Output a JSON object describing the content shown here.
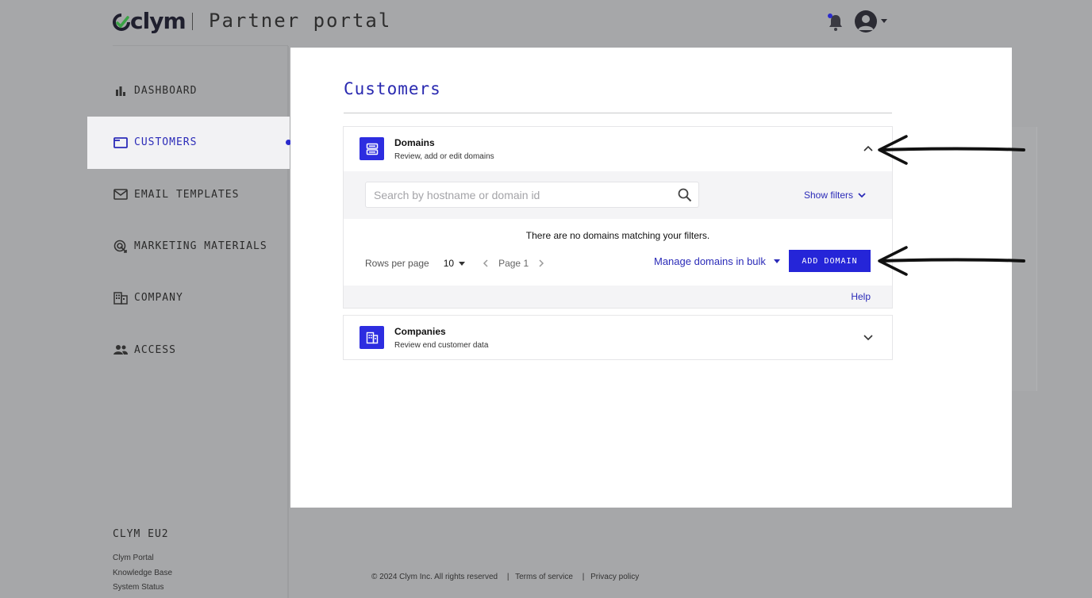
{
  "header": {
    "brand": "clym",
    "portal_title": "Partner portal"
  },
  "sidebar": {
    "items": [
      {
        "label": "DASHBOARD",
        "icon": "bar-chart-icon"
      },
      {
        "label": "CUSTOMERS",
        "icon": "folder-icon",
        "active": true
      },
      {
        "label": "EMAIL TEMPLATES",
        "icon": "mail-icon"
      },
      {
        "label": "MARKETING MATERIALS",
        "icon": "target-icon"
      },
      {
        "label": "COMPANY",
        "icon": "building-icon"
      },
      {
        "label": "ACCESS",
        "icon": "people-icon"
      }
    ],
    "environment": "CLYM EU2",
    "links": [
      "Clym Portal",
      "Knowledge Base",
      "System Status"
    ]
  },
  "main": {
    "title": "Customers",
    "domains": {
      "title": "Domains",
      "subtitle": "Review, add or edit domains",
      "search_placeholder": "Search by hostname or domain id",
      "show_filters": "Show filters",
      "empty_message": "There are no domains matching your filters.",
      "rows_per_page_label": "Rows per page",
      "rows_per_page_value": "10",
      "page_label": "Page 1",
      "manage_bulk": "Manage domains in bulk",
      "add_domain": "ADD DOMAIN",
      "help": "Help"
    },
    "companies": {
      "title": "Companies",
      "subtitle": "Review end customer data"
    }
  },
  "footer": {
    "copyright": "© 2024 Clym Inc. All rights reserved",
    "terms": "Terms of service",
    "privacy": "Privacy policy",
    "separator": "|"
  },
  "colors": {
    "accent": "#2525d8",
    "link": "#2b2bb8",
    "overlay": "#a6a7a9"
  }
}
